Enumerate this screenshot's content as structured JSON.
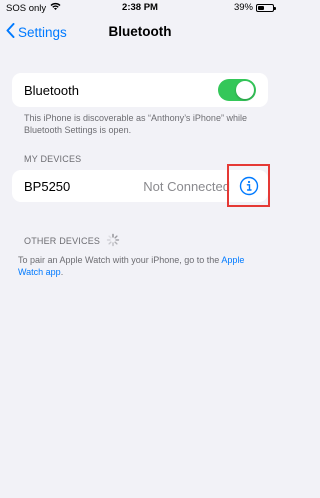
{
  "status_bar": {
    "carrier": "SOS only",
    "time": "2:38 PM",
    "battery": "39%"
  },
  "nav": {
    "back_label": "Settings",
    "title": "Bluetooth"
  },
  "bluetooth": {
    "label": "Bluetooth",
    "enabled": true,
    "footnote": "This iPhone is discoverable as “Anthony’s iPhone” while Bluetooth Settings is open."
  },
  "my_devices": {
    "header": "MY DEVICES",
    "items": [
      {
        "name": "BP5250",
        "status": "Not Connected"
      }
    ]
  },
  "other_devices": {
    "header": "OTHER DEVICES"
  },
  "pairing": {
    "text": "To pair an Apple Watch with your iPhone, go to the",
    "link": "Apple Watch app",
    "suffix": "."
  },
  "colors": {
    "accent": "#007aff",
    "toggle_on": "#34c759",
    "highlight": "#e53935"
  },
  "icons": [
    "wifi-icon",
    "battery-icon",
    "chevron-left-icon",
    "info-icon",
    "spinner-icon"
  ]
}
